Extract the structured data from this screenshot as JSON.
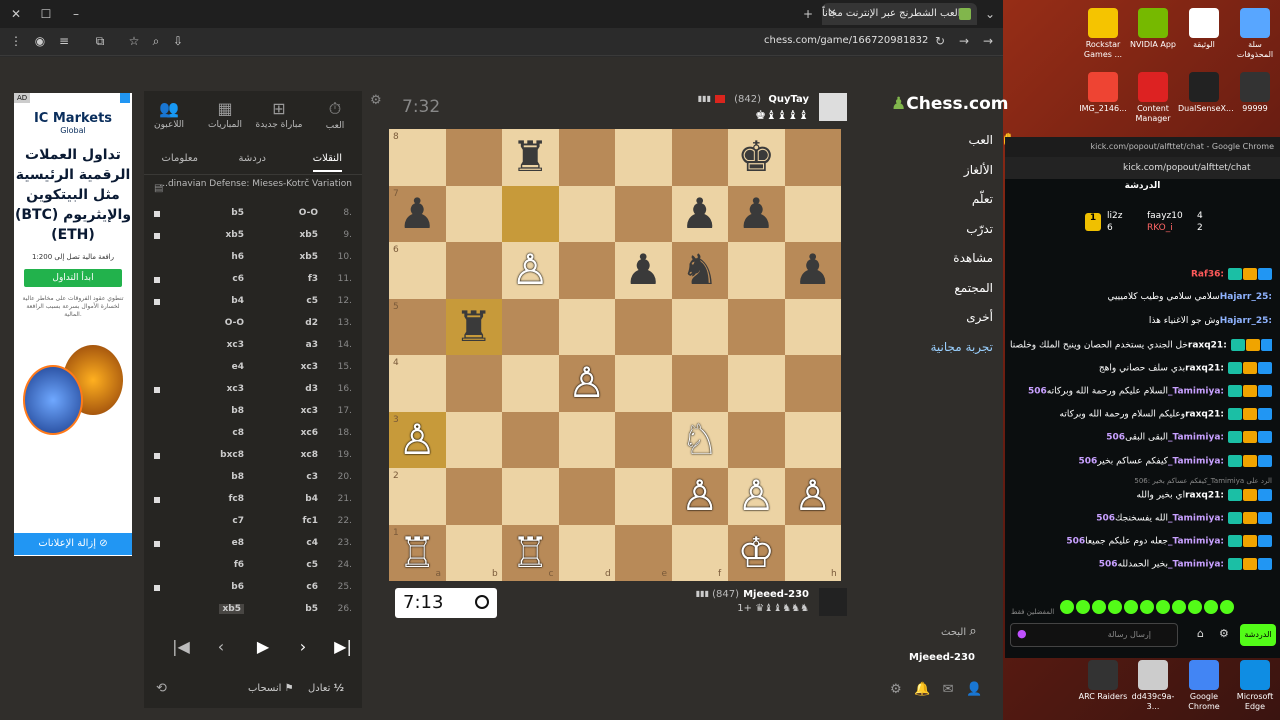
{
  "browser": {
    "tab_title": "العب الشطرنج عبر الإنترنت مجاناً",
    "url": "chess.com/game/166720981832"
  },
  "panel": {
    "tabs": [
      {
        "label": "العب",
        "icon": "stopwatch-icon"
      },
      {
        "label": "مباراة جديدة",
        "icon": "plus-icon"
      },
      {
        "label": "المباريات",
        "icon": "board-icon"
      },
      {
        "label": "اللاعبون",
        "icon": "players-icon"
      }
    ],
    "subtabs": [
      "النقلات",
      "دردشة",
      "معلومات"
    ],
    "opening": "...dinavian Defense: Mieses-Kotrč Variation",
    "moves": [
      {
        "n": "8.",
        "w": "O-O",
        "b": "b5"
      },
      {
        "n": "9.",
        "w": "xb5",
        "b": "xb5"
      },
      {
        "n": "10.",
        "w": "xb5",
        "b": "h6"
      },
      {
        "n": "11.",
        "w": "f3",
        "b": "c6"
      },
      {
        "n": "12.",
        "w": "c5",
        "b": "b4"
      },
      {
        "n": "13.",
        "w": "d2",
        "b": "O-O"
      },
      {
        "n": "14.",
        "w": "a3",
        "b": "xc3"
      },
      {
        "n": "15.",
        "w": "xc3",
        "b": "e4"
      },
      {
        "n": "16.",
        "w": "d3",
        "b": "xc3"
      },
      {
        "n": "17.",
        "w": "xc3",
        "b": "b8"
      },
      {
        "n": "18.",
        "w": "xc6",
        "b": "c8"
      },
      {
        "n": "19.",
        "w": "xc8",
        "b": "bxc8"
      },
      {
        "n": "20.",
        "w": "c3",
        "b": "b8"
      },
      {
        "n": "21.",
        "w": "b4",
        "b": "fc8"
      },
      {
        "n": "22.",
        "w": "fc1",
        "b": "c7"
      },
      {
        "n": "23.",
        "w": "c4",
        "b": "e8"
      },
      {
        "n": "24.",
        "w": "c5",
        "b": "f6"
      },
      {
        "n": "25.",
        "w": "c6",
        "b": "b6"
      },
      {
        "n": "26.",
        "w": "b5",
        "b": "xb5"
      }
    ],
    "bottom": {
      "draw": "تعادل",
      "resign": "انسحاب"
    }
  },
  "game": {
    "timer_top": "7:32",
    "timer_bottom": "7:13",
    "top_player": {
      "name": "QuyTay",
      "rating": "(842)",
      "captured": "♚♝♝♝♝"
    },
    "bottom_player": {
      "name": "Mjeeed-230",
      "rating": "(847)",
      "captured": "1+ ♛♝♝♞♞♞"
    },
    "files": [
      "a",
      "b",
      "c",
      "d",
      "e",
      "f",
      "h"
    ],
    "ranks": [
      "8",
      "7",
      "6",
      "5",
      "4",
      "3",
      "2",
      "1"
    ]
  },
  "site_nav": {
    "logo": "Chess.com",
    "items": [
      "العب",
      "الألغاز",
      "تعلّم",
      "تدرّب",
      "مشاهدة",
      "المجتمع",
      "أخرى",
      "تجربة مجانية"
    ],
    "search": "البحث",
    "username": "Mjeeed-230"
  },
  "ad": {
    "badge": "AD",
    "brand": "IC Markets",
    "brand_sub": "Global",
    "headline": "تداول العملات الرقمية الرئيسية مثل البيتكوين (BTC) والإيثريوم (ETH)",
    "leverage": "رافعة مالية تصل إلى 1:200",
    "cta": "ابدأ التداول",
    "disclaimer": "تنطوي عقود الفروقات على مخاطر عالية لخسارة الأموال بسرعة بسبب الرافعة المالية.",
    "remove": "إزالة الإعلانات"
  },
  "desktop": [
    {
      "label": "Rockstar Games ..."
    },
    {
      "label": "NVIDIA App"
    },
    {
      "label": "الوثيقة"
    },
    {
      "label": "سلة المحذوفات"
    },
    {
      "label": "IMG_2146..."
    },
    {
      "label": "Content Manager"
    },
    {
      "label": "DualSenseX..."
    },
    {
      "label": "99999"
    },
    {
      "label": "ARC Raiders"
    },
    {
      "label": "dd439c9a-3..."
    },
    {
      "label": "Google Chrome"
    },
    {
      "label": "Microsoft Edge"
    }
  ],
  "kick": {
    "window_title": "kick.com/popout/alfttet/chat - Google Chrome",
    "url": "kick.com/popout/alfttet/chat",
    "header": "الدردشة",
    "leaders": [
      {
        "rank": "1",
        "name": "li2z",
        "count": "6"
      },
      {
        "name": "faayz10",
        "count": "4"
      },
      {
        "name": "RKO_i",
        "count": "2"
      }
    ],
    "messages": [
      {
        "user": "Raf36",
        "text": ""
      },
      {
        "user": "Hajarr_25",
        "text": "سلامي سلامي وطيب كلاميييي"
      },
      {
        "user": "Hajarr_25",
        "text": "وش جو الأغنياء هذا"
      },
      {
        "user": "raxq21",
        "text": "خل الجندي يستخدم الحصان وينبح الملك وخلصنا"
      },
      {
        "user": "raxq21",
        "text": "بدي سلف حصاني واهج"
      },
      {
        "user": "506_Tamimiya",
        "text": "السلام عليكم ورحمة الله وبركاته"
      },
      {
        "user": "raxq21",
        "text": "وعليكم السلام ورحمة الله وبركاته"
      },
      {
        "user": "506_Tamimiya",
        "text": "البقى البقى"
      },
      {
        "user": "506_Tamimiya",
        "text": "كيفكم عساكم بخير"
      },
      {
        "user": "raxq21",
        "text": "اي بخير والله"
      },
      {
        "user": "506_Tamimiya",
        "text": "الله يفسخنجك"
      },
      {
        "user": "506_Tamimiya",
        "text": "جعله دوم عليكم جميعا"
      },
      {
        "user": "506_Tamimiya",
        "text": "بخير الحمدلله"
      }
    ],
    "reply_note": "كيفكم عساكم بخير :506_Tamimiya الرد على",
    "emotes_label": "المفضلين فقط",
    "input_placeholder": "إرسال رسالة",
    "send": "الدردشة"
  },
  "colors": {
    "chess_green": "#81b64c",
    "kick_green": "#53fc18",
    "board_light": "#ecd3a4",
    "board_dark": "#b88a58"
  }
}
